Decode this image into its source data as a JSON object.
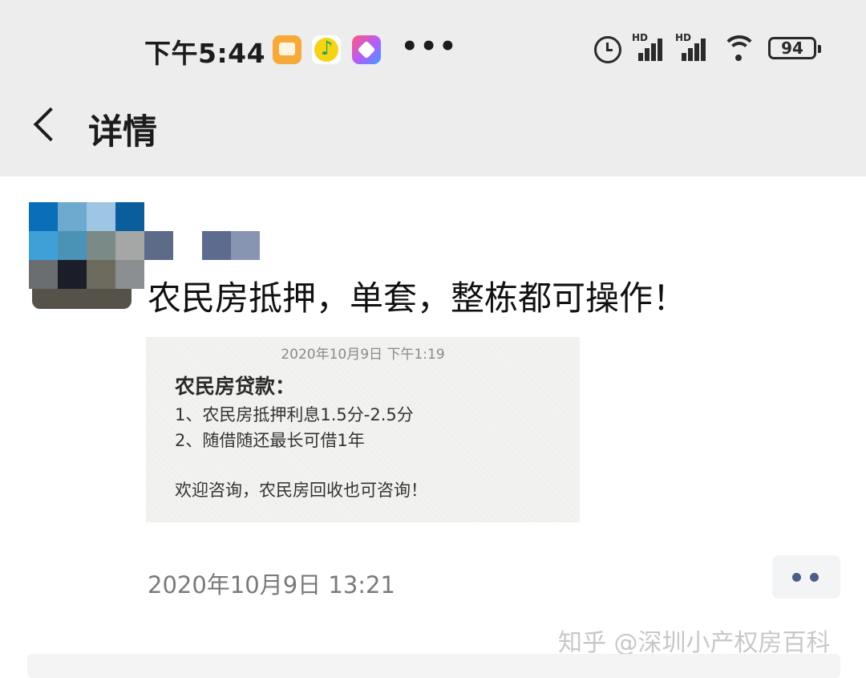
{
  "status_bar": {
    "time": "下午5:44",
    "network_1": "HD",
    "network_2": "HD",
    "battery_level": "94",
    "notification_icons": [
      "notes-app-icon",
      "qq-music-icon",
      "kite-app-icon"
    ],
    "more_indicator": "•••"
  },
  "nav": {
    "back_icon": "chevron-left-icon",
    "title": "详情"
  },
  "post": {
    "text": "农民房抵押，单套，整栋都可操作！",
    "image_card": {
      "timestamp": "2020年10月9日 下午1:19",
      "heading": "农民房贷款：",
      "lines": [
        "1、农民房抵押利息1.5分-2.5分",
        "2、随借随还最长可借1年",
        "欢迎咨询，农民房回收也可咨询！"
      ]
    },
    "time": "2020年10月9日 13:21",
    "more_button_icon": "two-dots-icon"
  },
  "watermark": "知乎 @深圳小产权房百科",
  "colors": {
    "header_bg": "#ededed",
    "accent": "#4c5d86",
    "text_primary": "#111111",
    "text_secondary": "#7a7a7a"
  }
}
